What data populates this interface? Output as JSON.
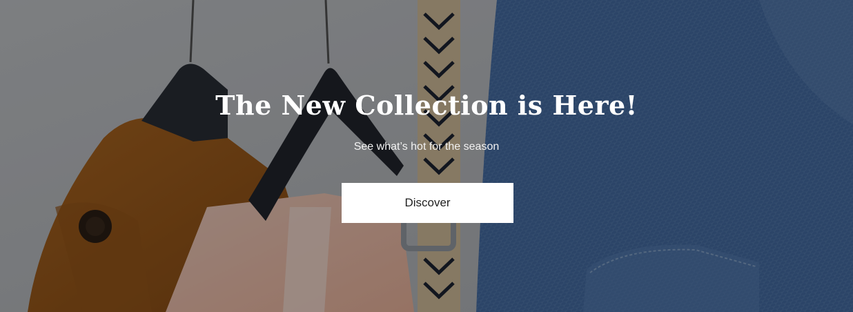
{
  "hero": {
    "headline": "The New Collection is Here!",
    "subheadline": "See what’s hot for the season",
    "cta_label": "Discover"
  },
  "colors": {
    "overlay": "#000000",
    "text": "#ffffff",
    "button_bg": "#ffffff",
    "button_text": "#1f1f1f"
  }
}
